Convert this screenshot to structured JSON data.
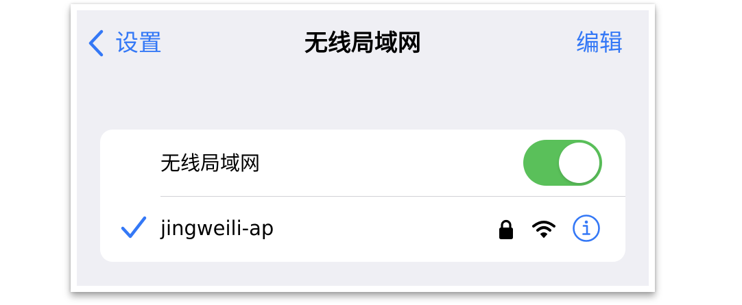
{
  "nav": {
    "back_label": "设置",
    "title": "无线局域网",
    "edit_label": "编辑"
  },
  "wifi_toggle": {
    "label": "无线局域网",
    "state": "on",
    "color": "#5ac05a"
  },
  "network": {
    "name": "jingweili-ap",
    "connected": true,
    "secured": true,
    "icons": [
      "checkmark-icon",
      "lock-icon",
      "wifi-signal-icon",
      "info-icon"
    ]
  },
  "colors": {
    "accent": "#3478f6",
    "background": "#efeff4"
  }
}
